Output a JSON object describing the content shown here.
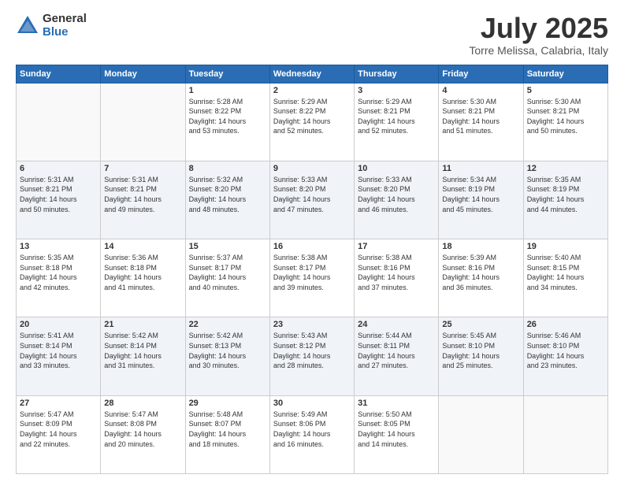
{
  "header": {
    "logo_general": "General",
    "logo_blue": "Blue",
    "title": "July 2025",
    "subtitle": "Torre Melissa, Calabria, Italy"
  },
  "days_of_week": [
    "Sunday",
    "Monday",
    "Tuesday",
    "Wednesday",
    "Thursday",
    "Friday",
    "Saturday"
  ],
  "weeks": [
    [
      {
        "day": "",
        "info": ""
      },
      {
        "day": "",
        "info": ""
      },
      {
        "day": "1",
        "info": "Sunrise: 5:28 AM\nSunset: 8:22 PM\nDaylight: 14 hours\nand 53 minutes."
      },
      {
        "day": "2",
        "info": "Sunrise: 5:29 AM\nSunset: 8:22 PM\nDaylight: 14 hours\nand 52 minutes."
      },
      {
        "day": "3",
        "info": "Sunrise: 5:29 AM\nSunset: 8:21 PM\nDaylight: 14 hours\nand 52 minutes."
      },
      {
        "day": "4",
        "info": "Sunrise: 5:30 AM\nSunset: 8:21 PM\nDaylight: 14 hours\nand 51 minutes."
      },
      {
        "day": "5",
        "info": "Sunrise: 5:30 AM\nSunset: 8:21 PM\nDaylight: 14 hours\nand 50 minutes."
      }
    ],
    [
      {
        "day": "6",
        "info": "Sunrise: 5:31 AM\nSunset: 8:21 PM\nDaylight: 14 hours\nand 50 minutes."
      },
      {
        "day": "7",
        "info": "Sunrise: 5:31 AM\nSunset: 8:21 PM\nDaylight: 14 hours\nand 49 minutes."
      },
      {
        "day": "8",
        "info": "Sunrise: 5:32 AM\nSunset: 8:20 PM\nDaylight: 14 hours\nand 48 minutes."
      },
      {
        "day": "9",
        "info": "Sunrise: 5:33 AM\nSunset: 8:20 PM\nDaylight: 14 hours\nand 47 minutes."
      },
      {
        "day": "10",
        "info": "Sunrise: 5:33 AM\nSunset: 8:20 PM\nDaylight: 14 hours\nand 46 minutes."
      },
      {
        "day": "11",
        "info": "Sunrise: 5:34 AM\nSunset: 8:19 PM\nDaylight: 14 hours\nand 45 minutes."
      },
      {
        "day": "12",
        "info": "Sunrise: 5:35 AM\nSunset: 8:19 PM\nDaylight: 14 hours\nand 44 minutes."
      }
    ],
    [
      {
        "day": "13",
        "info": "Sunrise: 5:35 AM\nSunset: 8:18 PM\nDaylight: 14 hours\nand 42 minutes."
      },
      {
        "day": "14",
        "info": "Sunrise: 5:36 AM\nSunset: 8:18 PM\nDaylight: 14 hours\nand 41 minutes."
      },
      {
        "day": "15",
        "info": "Sunrise: 5:37 AM\nSunset: 8:17 PM\nDaylight: 14 hours\nand 40 minutes."
      },
      {
        "day": "16",
        "info": "Sunrise: 5:38 AM\nSunset: 8:17 PM\nDaylight: 14 hours\nand 39 minutes."
      },
      {
        "day": "17",
        "info": "Sunrise: 5:38 AM\nSunset: 8:16 PM\nDaylight: 14 hours\nand 37 minutes."
      },
      {
        "day": "18",
        "info": "Sunrise: 5:39 AM\nSunset: 8:16 PM\nDaylight: 14 hours\nand 36 minutes."
      },
      {
        "day": "19",
        "info": "Sunrise: 5:40 AM\nSunset: 8:15 PM\nDaylight: 14 hours\nand 34 minutes."
      }
    ],
    [
      {
        "day": "20",
        "info": "Sunrise: 5:41 AM\nSunset: 8:14 PM\nDaylight: 14 hours\nand 33 minutes."
      },
      {
        "day": "21",
        "info": "Sunrise: 5:42 AM\nSunset: 8:14 PM\nDaylight: 14 hours\nand 31 minutes."
      },
      {
        "day": "22",
        "info": "Sunrise: 5:42 AM\nSunset: 8:13 PM\nDaylight: 14 hours\nand 30 minutes."
      },
      {
        "day": "23",
        "info": "Sunrise: 5:43 AM\nSunset: 8:12 PM\nDaylight: 14 hours\nand 28 minutes."
      },
      {
        "day": "24",
        "info": "Sunrise: 5:44 AM\nSunset: 8:11 PM\nDaylight: 14 hours\nand 27 minutes."
      },
      {
        "day": "25",
        "info": "Sunrise: 5:45 AM\nSunset: 8:10 PM\nDaylight: 14 hours\nand 25 minutes."
      },
      {
        "day": "26",
        "info": "Sunrise: 5:46 AM\nSunset: 8:10 PM\nDaylight: 14 hours\nand 23 minutes."
      }
    ],
    [
      {
        "day": "27",
        "info": "Sunrise: 5:47 AM\nSunset: 8:09 PM\nDaylight: 14 hours\nand 22 minutes."
      },
      {
        "day": "28",
        "info": "Sunrise: 5:47 AM\nSunset: 8:08 PM\nDaylight: 14 hours\nand 20 minutes."
      },
      {
        "day": "29",
        "info": "Sunrise: 5:48 AM\nSunset: 8:07 PM\nDaylight: 14 hours\nand 18 minutes."
      },
      {
        "day": "30",
        "info": "Sunrise: 5:49 AM\nSunset: 8:06 PM\nDaylight: 14 hours\nand 16 minutes."
      },
      {
        "day": "31",
        "info": "Sunrise: 5:50 AM\nSunset: 8:05 PM\nDaylight: 14 hours\nand 14 minutes."
      },
      {
        "day": "",
        "info": ""
      },
      {
        "day": "",
        "info": ""
      }
    ]
  ]
}
